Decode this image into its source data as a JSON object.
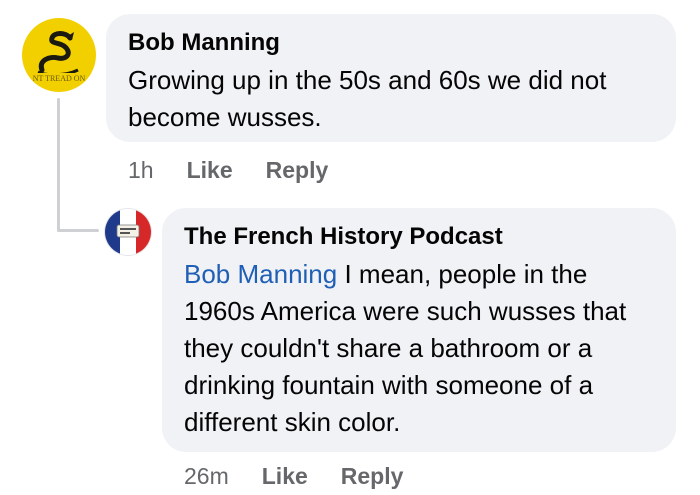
{
  "comments": [
    {
      "author": "Bob Manning",
      "avatar_text": "NT TREAD ON",
      "text": "Growing up in the 50s and 60s we did not become wusses.",
      "time": "1h",
      "like_label": "Like",
      "reply_label": "Reply"
    },
    {
      "author": "The French History Podcast",
      "mention": "Bob Manning",
      "text": " I mean, people in the 1960s America were such wusses that they couldn't share a bathroom or a drinking fountain with someone of a different skin color.",
      "time": "26m",
      "like_label": "Like",
      "reply_label": "Reply"
    }
  ],
  "colors": {
    "bubble": "#f0f2f5",
    "mention": "#1f5fb6",
    "meta": "#65676b",
    "thread_line": "#ced0d4",
    "gadsden_yellow": "#f2d000"
  },
  "icons": [
    "gadsden-flag-avatar",
    "french-flag-avatar"
  ]
}
